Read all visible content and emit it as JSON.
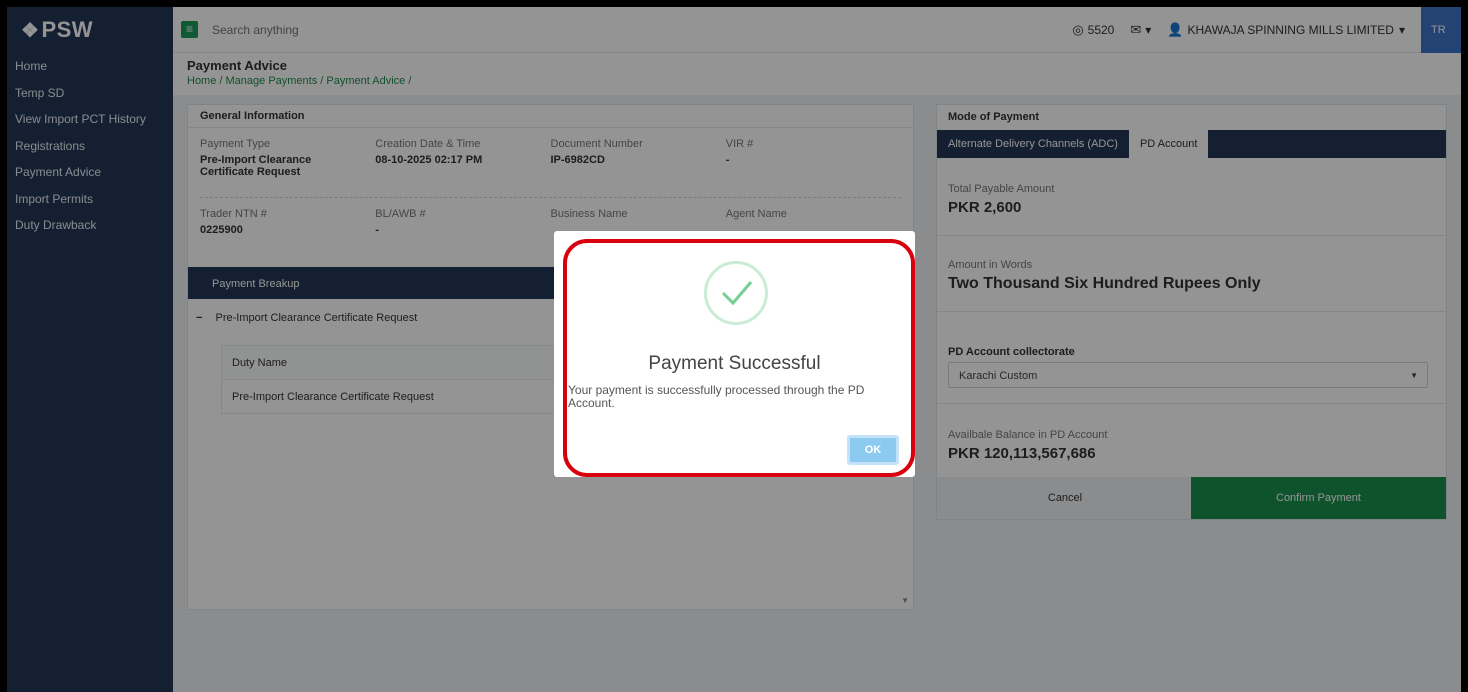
{
  "app": {
    "logo": "PSW"
  },
  "sidebar": {
    "items": [
      {
        "label": "Home"
      },
      {
        "label": "Temp SD"
      },
      {
        "label": "View Import PCT History"
      },
      {
        "label": "Registrations"
      },
      {
        "label": "Payment Advice"
      },
      {
        "label": "Import Permits"
      },
      {
        "label": "Duty Drawback"
      }
    ]
  },
  "topbar": {
    "search_placeholder": "Search anything",
    "coins": "5520",
    "user": "KHAWAJA SPINNING MILLS LIMITED",
    "role": "TR"
  },
  "page": {
    "title": "Payment Advice",
    "breadcrumb": "Home / Manage Payments / Payment Advice /"
  },
  "general": {
    "title": "General Information",
    "row1": [
      {
        "label": "Payment Type",
        "value": "Pre-Import Clearance Certificate Request"
      },
      {
        "label": "Creation Date & Time",
        "value": "08-10-2025 02:17 PM"
      },
      {
        "label": "Document Number",
        "value": "IP-6982CD"
      },
      {
        "label": "VIR #",
        "value": "-"
      }
    ],
    "row2": [
      {
        "label": "Trader NTN #",
        "value": "0225900"
      },
      {
        "label": "BL/AWB #",
        "value": "-"
      },
      {
        "label": "Business Name",
        "value": ""
      },
      {
        "label": "Agent Name",
        "value": ""
      }
    ],
    "breakup": {
      "title": "Payment Breakup",
      "group": "Pre-Import Clearance Certificate Request",
      "table_header": "Duty Name",
      "rows": [
        "Pre-Import Clearance Certificate Request"
      ]
    }
  },
  "payment": {
    "title": "Mode of Payment",
    "tabs": [
      "Alternate Delivery Channels (ADC)",
      "PD Account"
    ],
    "total_label": "Total Payable Amount",
    "total_value": "PKR 2,600",
    "words_label": "Amount in Words",
    "words_value": "Two Thousand Six Hundred Rupees Only",
    "collectorate_label": "PD Account collectorate",
    "collectorate_value": "Karachi Custom",
    "balance_label": "Availbale Balance in PD Account",
    "balance_value": "PKR 120,113,567,686",
    "cancel": "Cancel",
    "confirm": "Confirm Payment"
  },
  "modal": {
    "title": "Payment Successful",
    "message": "Your payment is successfully processed through the PD Account.",
    "ok": "OK"
  },
  "colors": {
    "sidebar": "#243856",
    "accent_green": "#1a8f4f",
    "highlight_ring": "#d9000d",
    "ok_button": "#8ccaf2"
  }
}
